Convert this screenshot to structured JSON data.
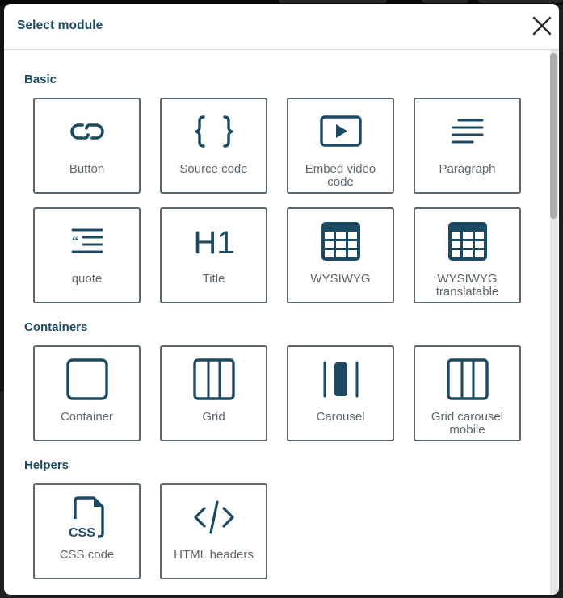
{
  "modal": {
    "title": "Select module",
    "close_icon": "close-icon"
  },
  "colors": {
    "accent": "#1d4a63",
    "card_border": "#5d6770",
    "label_text": "#5e666d",
    "divider": "#d9dde2",
    "scrollbar_thumb": "#aeaeae",
    "scrollbar_track": "#e6e6e6"
  },
  "sections": [
    {
      "title": "Basic",
      "items": [
        {
          "label": "Button",
          "icon": "link-icon"
        },
        {
          "label": "Source code",
          "icon": "braces-icon"
        },
        {
          "label": "Embed video code",
          "icon": "video-play-icon"
        },
        {
          "label": "Paragraph",
          "icon": "text-lines-icon"
        },
        {
          "label": "quote",
          "icon": "quote-icon"
        },
        {
          "label": "Title",
          "icon": "heading-h1-icon"
        },
        {
          "label": "WYSIWYG",
          "icon": "table-icon"
        },
        {
          "label": "WYSIWYG translatable",
          "icon": "table-icon"
        }
      ]
    },
    {
      "title": "Containers",
      "items": [
        {
          "label": "Container",
          "icon": "square-icon"
        },
        {
          "label": "Grid",
          "icon": "grid-columns-icon"
        },
        {
          "label": "Carousel",
          "icon": "carousel-icon"
        },
        {
          "label": "Grid carousel mobile",
          "icon": "grid-columns-icon"
        }
      ]
    },
    {
      "title": "Helpers",
      "items": [
        {
          "label": "CSS code",
          "icon": "css-file-icon"
        },
        {
          "label": "HTML headers",
          "icon": "code-tag-icon"
        }
      ]
    }
  ],
  "labels_split": {
    "embed_video_line1": "Embed video",
    "embed_video_line2": "code",
    "wysiwyg_tr_line1": "WYSIWYG",
    "wysiwyg_tr_line2": "translatable",
    "grid_carousel_line1": "Grid carousel",
    "grid_carousel_line2": "mobile",
    "h1_glyph": "H1",
    "css_glyph": "CSS"
  }
}
